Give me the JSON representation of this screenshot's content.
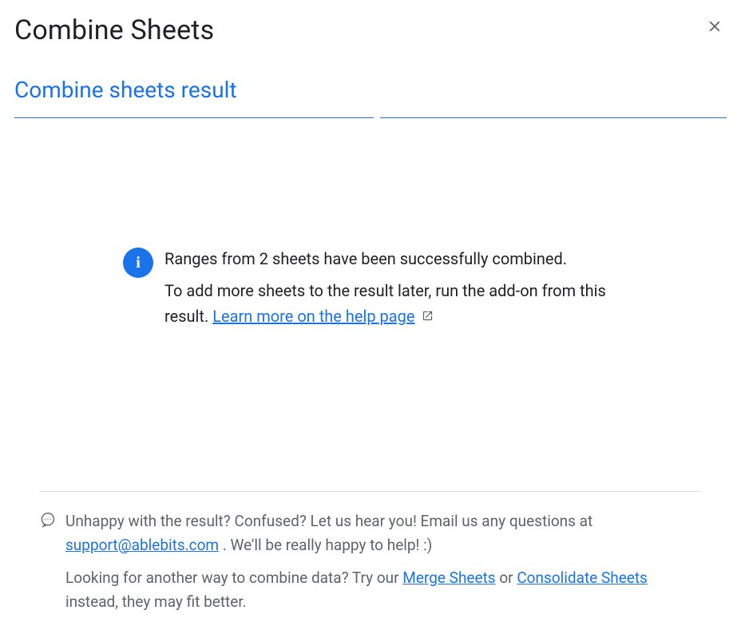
{
  "header": {
    "title": "Combine Sheets"
  },
  "subtitle": "Combine sheets result",
  "info": {
    "line1": "Ranges from 2 sheets have been successfully combined.",
    "line2_a": "To add more sheets to the result later, run the add-on from this result. ",
    "learn_more": "Learn more on the help page"
  },
  "footer": {
    "p1_a": "Unhappy with the result? Confused? Let us hear you! Email us any questions at ",
    "email": "support@ablebits.com",
    "p1_b": " . We'll be really happy to help! :)",
    "p2_a": "Looking for another way to combine data? Try our ",
    "merge_link": "Merge Sheets",
    "p2_b": " or ",
    "consolidate_link": "Consolidate Sheets",
    "p2_c": " instead, they may fit better."
  }
}
